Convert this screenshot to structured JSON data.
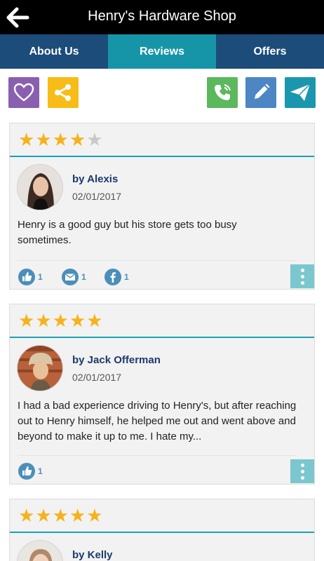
{
  "header": {
    "title": "Henry's Hardware Shop"
  },
  "tabs": [
    {
      "label": "About Us",
      "active": false
    },
    {
      "label": "Reviews",
      "active": true
    },
    {
      "label": "Offers",
      "active": false
    }
  ],
  "colors": {
    "tab_bg": "#1b4c7a",
    "tab_active": "#1795a8",
    "favorite": "#8b5fb0",
    "share": "#f7bc17",
    "call": "#5cb85c",
    "edit": "#4d86c4",
    "send": "#1a97ae",
    "star": "#f6b21a",
    "divider": "#1aa0b8"
  },
  "action_icons": [
    "heart-icon",
    "share-icon",
    "phone-icon",
    "pencil-icon",
    "paper-plane-icon"
  ],
  "reviews": [
    {
      "rating": 4,
      "max": 5,
      "author": "by Alexis",
      "date": "02/01/2017",
      "text": "Henry is a good guy but his store gets too busy sometimes.",
      "likes": "1",
      "emails": "1",
      "shares": "1"
    },
    {
      "rating": 5,
      "max": 5,
      "author": "by Jack Offerman",
      "date": "02/01/2017",
      "text": "I had a bad experience driving to Henry's,  but after reaching out to Henry himself, he helped me out and went above and beyond to make it up to me. I hate my...",
      "likes": "1"
    },
    {
      "rating": 5,
      "max": 5,
      "author": "by Kelly"
    }
  ]
}
